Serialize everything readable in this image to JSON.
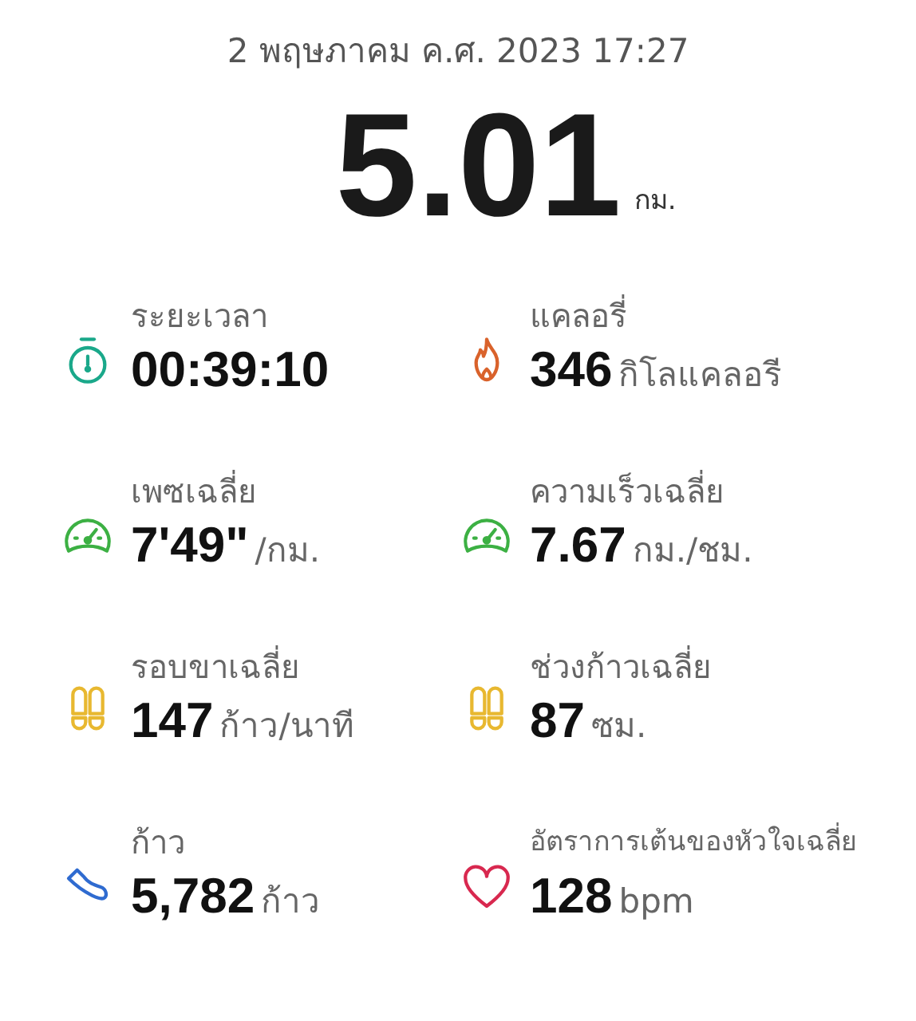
{
  "date": "2 พฤษภาคม ค.ศ. 2023 17:27",
  "distance": {
    "value": "5.01",
    "unit": "กม."
  },
  "stats": [
    {
      "kind": "stopwatch",
      "color": "#1aa88a",
      "label": "ระยะเวลา",
      "value": "00:39:10"
    },
    {
      "kind": "flame",
      "color": "#d9622b",
      "label": "แคลอรี่",
      "value": "346",
      "unit": "กิโลแคลอรี"
    },
    {
      "kind": "gauge",
      "color": "#3cb043",
      "label": "เพซเฉลี่ย",
      "value": "7'49\"",
      "unit": "/กม."
    },
    {
      "kind": "gauge",
      "color": "#3cb043",
      "label": "ความเร็วเฉลี่ย",
      "value": "7.67",
      "unit": "กม./ชม."
    },
    {
      "kind": "footprints",
      "color": "#e8b830",
      "label": "รอบขาเฉลี่ย",
      "value": "147",
      "unit": "ก้าว/นาที"
    },
    {
      "kind": "footprints",
      "color": "#e8b830",
      "label": "ช่วงก้าวเฉลี่ย",
      "value": "87",
      "unit": "ซม."
    },
    {
      "kind": "shoe",
      "color": "#2f6bd0",
      "label": "ก้าว",
      "value": "5,782",
      "unit": "ก้าว"
    },
    {
      "kind": "heart",
      "color": "#d8284f",
      "label": "อัตราการเต้นของหัวใจเฉลี่ย",
      "value": "128",
      "unit": "bpm"
    }
  ]
}
